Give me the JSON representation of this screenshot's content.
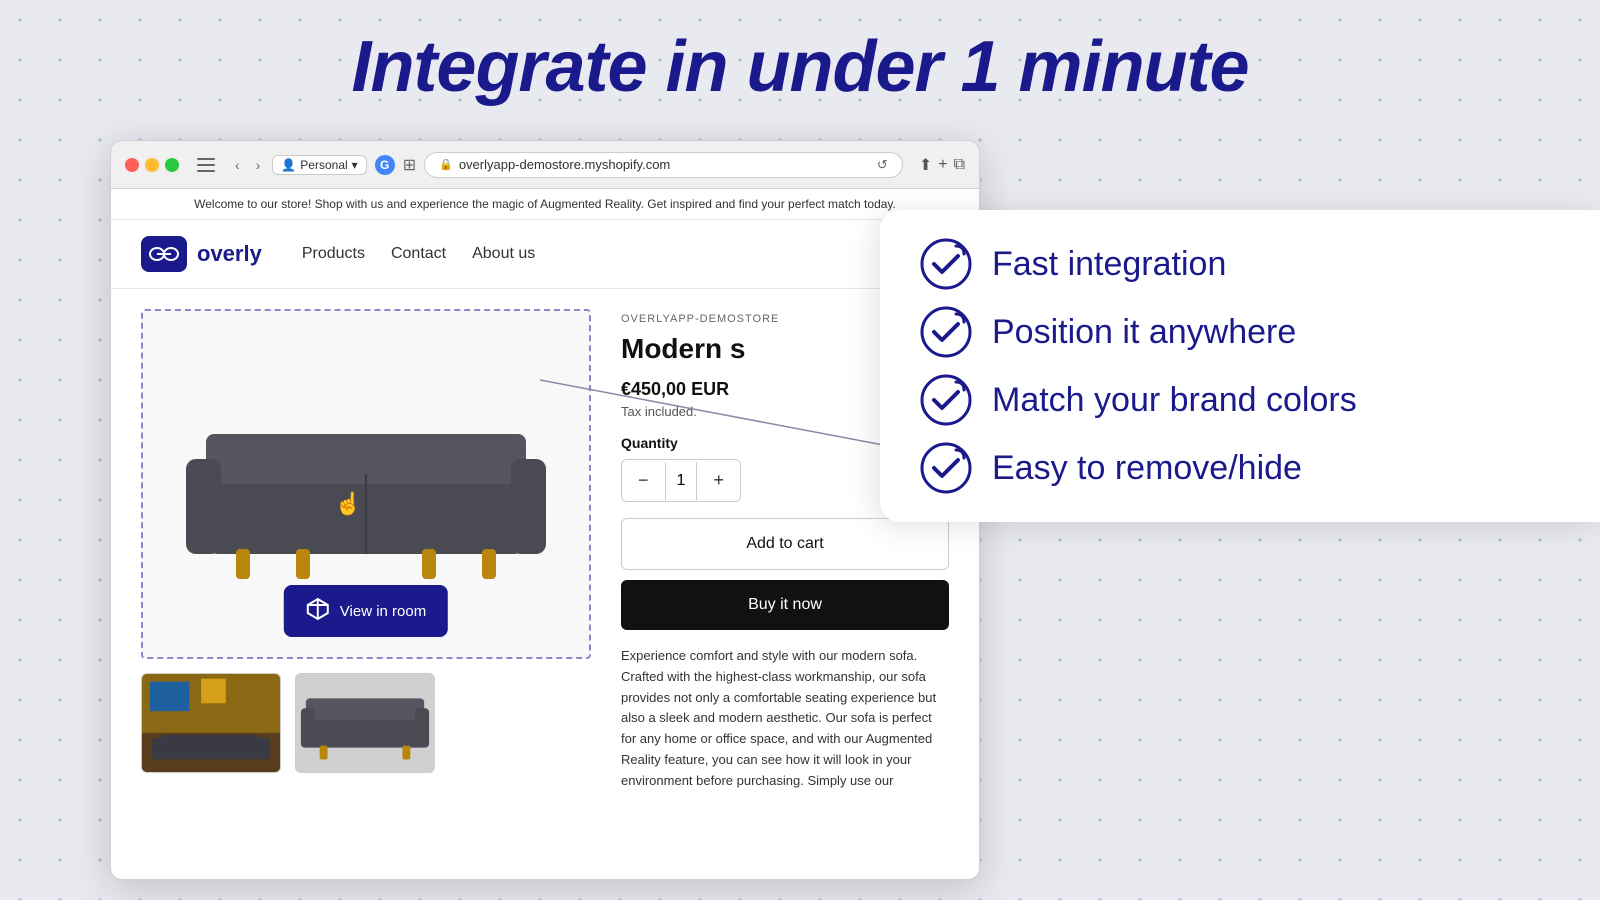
{
  "page": {
    "title": "Integrate in under 1 minute"
  },
  "browser": {
    "profile": "Personal",
    "address": "overlyapp-demostore.myshopify.com",
    "favicon": "G"
  },
  "store": {
    "announcement": "Welcome to our store! Shop with us and experience the magic of Augmented Reality. Get inspired and find your perfect match today.",
    "logo_text": "overly",
    "nav_links": [
      "Products",
      "Contact",
      "About us"
    ]
  },
  "product": {
    "store_name": "OVERLYAPP-DEMOSTORE",
    "title": "Modern s",
    "price": "€450,00 EUR",
    "tax_note": "Tax included.",
    "quantity_label": "Quantity",
    "quantity": "1",
    "add_to_cart": "Add to cart",
    "buy_now": "Buy it now",
    "description": "Experience comfort and style with our modern sofa. Crafted with the highest-class workmanship, our sofa provides not only a comfortable seating experience but also a sleek and modern aesthetic. Our sofa is perfect for any home or office space, and with our Augmented Reality feature, you can see how it will look in your environment before purchasing. Simply use our",
    "view_in_room": "View in room"
  },
  "features": [
    {
      "id": "fast-integration",
      "text": "Fast integration"
    },
    {
      "id": "position-anywhere",
      "text": "Position it anywhere"
    },
    {
      "id": "match-colors",
      "text": "Match your brand colors"
    },
    {
      "id": "easy-hide",
      "text": "Easy to remove/hide"
    }
  ]
}
